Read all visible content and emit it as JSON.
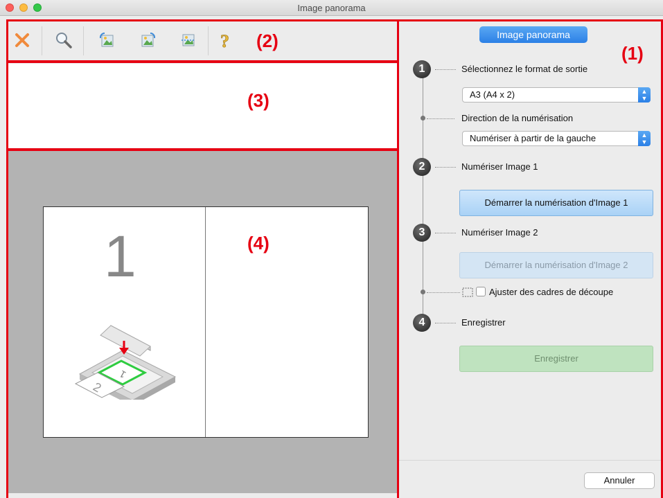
{
  "window": {
    "title": "Image panorama"
  },
  "toolbar": {
    "buttons": [
      {
        "icon": "delete-x-icon"
      },
      {
        "icon": "magnifier-icon"
      },
      {
        "icon": "image-rotate-left-icon"
      },
      {
        "icon": "image-rotate-right-icon"
      },
      {
        "icon": "image-invert-icon"
      },
      {
        "icon": "help-icon"
      }
    ]
  },
  "region_labels": {
    "r1": "(1)",
    "r2": "(2)",
    "r3": "(3)",
    "r4": "(4)"
  },
  "panel": {
    "mode_button": "Image panorama",
    "steps": [
      {
        "num": "1",
        "label": "Sélectionnez le format de sortie"
      },
      {
        "num": "2",
        "label": "Numériser Image 1"
      },
      {
        "num": "3",
        "label": "Numériser Image 2"
      },
      {
        "num": "4",
        "label": "Enregistrer"
      }
    ],
    "output_format": {
      "value": "A3 (A4 x 2)"
    },
    "scan_direction": {
      "label": "Direction de la numérisation",
      "value": "Numériser à partir de la gauche"
    },
    "scan1_button": "Démarrer la numérisation d'Image 1",
    "scan2_button": "Démarrer la numérisation d'Image 2",
    "adjust_crop": {
      "label": "Ajuster des cadres de découpe",
      "checked": false
    },
    "save_button": "Enregistrer",
    "cancel_button": "Annuler"
  },
  "preview": {
    "page_number": "1"
  },
  "colors": {
    "highlight_red": "#e60012",
    "accent_blue": "#2b80e6",
    "save_green": "#bfe3bf"
  }
}
